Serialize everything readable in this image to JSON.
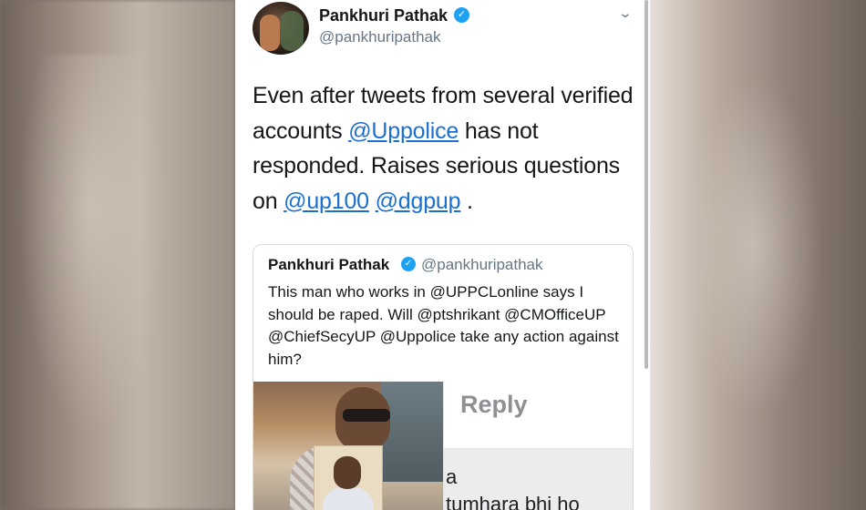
{
  "author": {
    "name": "Pankhuri Pathak",
    "handle": "@pankhuripathak",
    "verified_mark": "✓"
  },
  "tweet": {
    "text_1": "Even after tweets from several verified accounts ",
    "mention_1": "@Uppolice",
    "text_2": " has not responded. Raises serious questions on ",
    "mention_2": "@up100",
    "text_3": " ",
    "mention_3": "@dgpup",
    "text_4": " ."
  },
  "quoted": {
    "name": "Pankhuri Pathak",
    "handle": "@pankhuripathak",
    "verified_mark": "✓",
    "text": "This man who works in @UPPCLonline says I should be raped. Will @ptshrikant @CMOfficeUP @ChiefSecyUP @Uppolice take any action against him?",
    "media": {
      "reply_label": "Reply",
      "comment_text": "a\ntumhara bhi ho"
    }
  },
  "icons": {
    "menu_chevron": "⌄"
  },
  "colors": {
    "link": "#1b6fd1",
    "verified": "#1da1f2",
    "secondary_text": "#657786"
  }
}
